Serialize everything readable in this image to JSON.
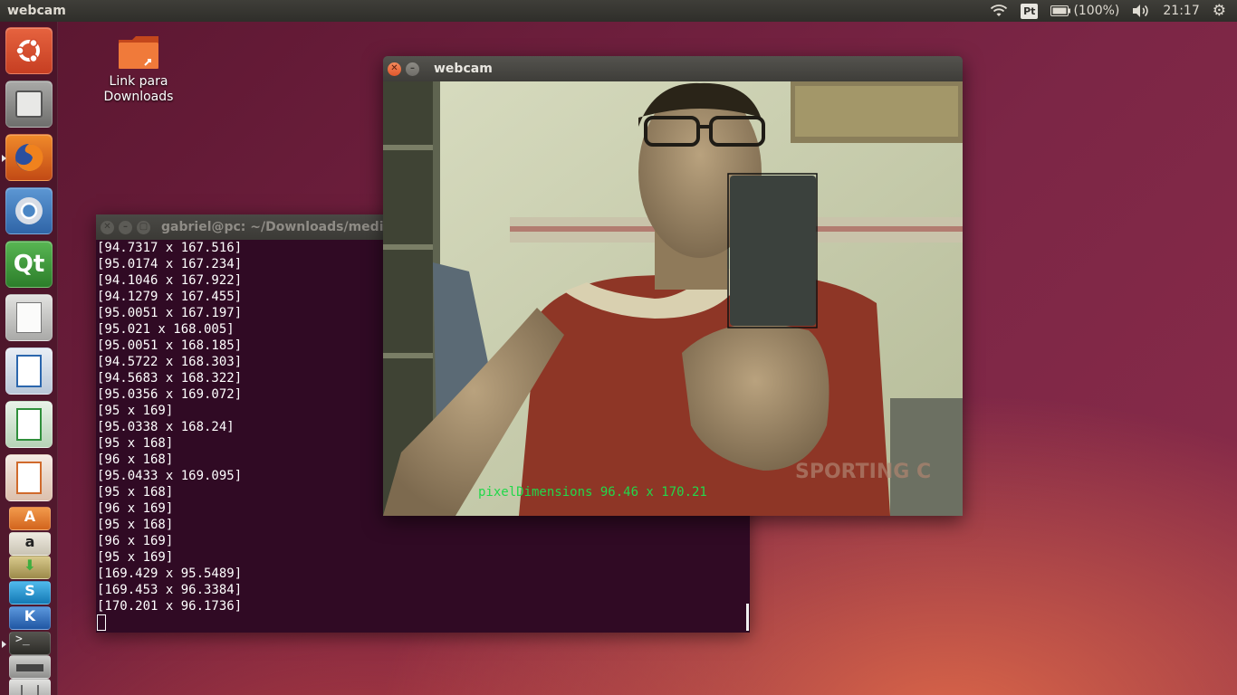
{
  "top_panel": {
    "app_title": "webcam",
    "keyboard_layout": "Pt",
    "battery": "(100%)",
    "clock": "21:17",
    "icons": [
      "wifi-icon",
      "keyboard-icon",
      "battery-icon",
      "volume-icon",
      "settings-gear-icon"
    ]
  },
  "launcher": {
    "items": [
      {
        "name": "ubuntu-dash",
        "icon": "ubuntu-logo-icon",
        "color": "#d24b2d"
      },
      {
        "name": "files",
        "icon": "file-cabinet-icon",
        "color": "#8a8a88"
      },
      {
        "name": "firefox",
        "icon": "firefox-icon",
        "color": "#e2661f"
      },
      {
        "name": "chromium",
        "icon": "chromium-icon",
        "color": "#4a86c5"
      },
      {
        "name": "qt-creator",
        "icon": "qt-icon",
        "color": "#3e9a3c"
      },
      {
        "name": "text-editor",
        "icon": "text-editor-icon",
        "color": "#c9c9c7"
      },
      {
        "name": "libreoffice-writer",
        "icon": "writer-icon",
        "color": "#2b66ad"
      },
      {
        "name": "libreoffice-calc",
        "icon": "calc-icon",
        "color": "#2f8f3b"
      },
      {
        "name": "libreoffice-impress",
        "icon": "impress-icon",
        "color": "#d06a2c"
      },
      {
        "name": "software-center",
        "icon": "software-center-icon",
        "color": "#e97b2c"
      },
      {
        "name": "amazon",
        "icon": "amazon-icon",
        "color": "#d8d3c6"
      },
      {
        "name": "software-updater",
        "icon": "updater-icon",
        "color": "#b7a56a"
      },
      {
        "name": "skype",
        "icon": "skype-icon",
        "color": "#1a9bdb"
      },
      {
        "name": "kde-app",
        "icon": "k-icon",
        "color": "#3576c4"
      },
      {
        "name": "terminal",
        "icon": "terminal-icon",
        "color": "#3b3a36"
      },
      {
        "name": "scanner",
        "icon": "scanner-icon",
        "color": "#9a9a98"
      },
      {
        "name": "trash",
        "icon": "trash-icon",
        "color": "#b9b9b7"
      }
    ]
  },
  "desktop": {
    "downloads_link_label": "Link para Downloads"
  },
  "terminal": {
    "title": "gabriel@pc: ~/Downloads/medir_d",
    "lines": [
      "[94.7317 x 167.516]",
      "[95.0174 x 167.234]",
      "[94.1046 x 167.922]",
      "[94.1279 x 167.455]",
      "[95.0051 x 167.197]",
      "[95.021 x 168.005]",
      "[95.0051 x 168.185]",
      "[94.5722 x 168.303]",
      "[94.5683 x 168.322]",
      "[95.0356 x 169.072]",
      "[95 x 169]",
      "[95.0338 x 168.24]",
      "[95 x 168]",
      "[96 x 168]",
      "[95.0433 x 169.095]",
      "[95 x 168]",
      "[96 x 169]",
      "[95 x 168]",
      "[96 x 169]",
      "[95 x 169]",
      "[169.429 x 95.5489]",
      "[169.453 x 96.3384]",
      "[170.201 x 96.1736]"
    ]
  },
  "webcam_window": {
    "title": "webcam",
    "overlay_text": "pixelDimensions 96.46 x 170.21",
    "overlay_color": "#22d84a"
  }
}
